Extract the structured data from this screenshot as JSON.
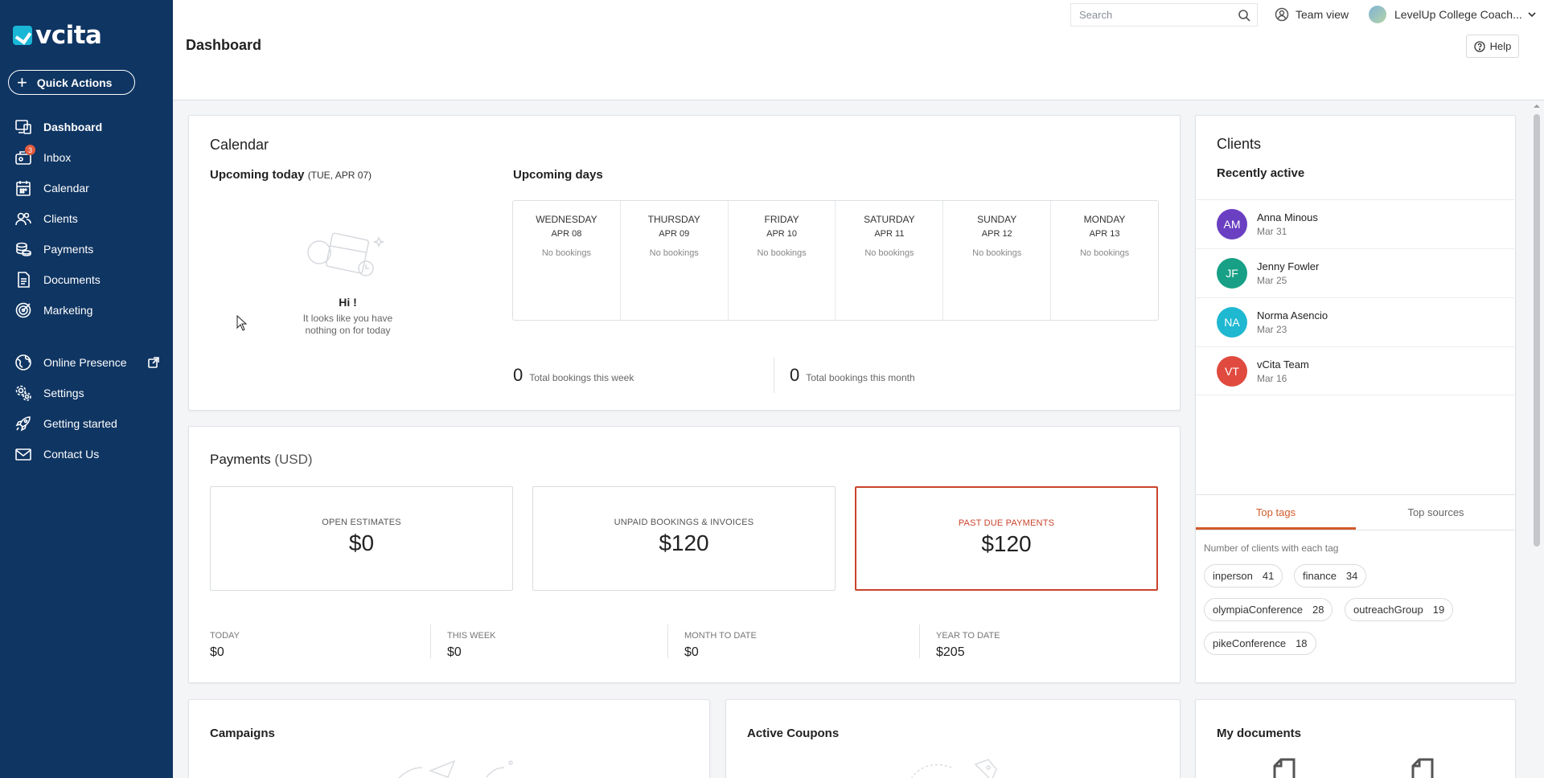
{
  "app": {
    "logo_text": "vcita",
    "quick_actions_label": "Quick Actions"
  },
  "colors": {
    "sidebar_bg": "#0f3562",
    "accent_alert": "#c9442c",
    "tab_active": "#d35a2b"
  },
  "nav": {
    "dashboard": "Dashboard",
    "inbox": "Inbox",
    "inbox_badge": "3",
    "calendar": "Calendar",
    "clients": "Clients",
    "payments": "Payments",
    "documents": "Documents",
    "marketing": "Marketing",
    "online_presence": "Online Presence",
    "settings": "Settings",
    "getting_started": "Getting started",
    "contact_us": "Contact Us"
  },
  "header": {
    "title": "Dashboard",
    "search_placeholder": "Search",
    "team_view": "Team view",
    "account_name": "LevelUp College Coach...",
    "help": "Help"
  },
  "calendar": {
    "title": "Calendar",
    "upcoming_today": "Upcoming today",
    "today_date": "(TUE, APR 07)",
    "upcoming_days": "Upcoming days",
    "hi": "Hi !",
    "empty_line1": "It looks like you have",
    "empty_line2": "nothing on for today",
    "days": [
      {
        "name": "WEDNESDAY",
        "date": "APR 08",
        "status": "No bookings"
      },
      {
        "name": "THURSDAY",
        "date": "APR 09",
        "status": "No bookings"
      },
      {
        "name": "FRIDAY",
        "date": "APR 10",
        "status": "No bookings"
      },
      {
        "name": "SATURDAY",
        "date": "APR 11",
        "status": "No bookings"
      },
      {
        "name": "SUNDAY",
        "date": "APR 12",
        "status": "No bookings"
      },
      {
        "name": "MONDAY",
        "date": "APR 13",
        "status": "No bookings"
      }
    ],
    "week_total": "0",
    "week_label": "Total bookings this week",
    "month_total": "0",
    "month_label": "Total bookings this month"
  },
  "payments": {
    "title": "Payments",
    "currency": "(USD)",
    "boxes": [
      {
        "label": "OPEN ESTIMATES",
        "value": "$0"
      },
      {
        "label": "UNPAID BOOKINGS & INVOICES",
        "value": "$120"
      },
      {
        "label": "PAST DUE PAYMENTS",
        "value": "$120"
      }
    ],
    "stats": [
      {
        "label": "TODAY",
        "value": "$0"
      },
      {
        "label": "THIS WEEK",
        "value": "$0"
      },
      {
        "label": "MONTH TO DATE",
        "value": "$0"
      },
      {
        "label": "YEAR TO DATE",
        "value": "$205"
      }
    ]
  },
  "clients": {
    "title": "Clients",
    "subtitle": "Recently active",
    "list": [
      {
        "initials": "AM",
        "name": "Anna Minous",
        "date": "Mar 31",
        "color": "#6a3fc1"
      },
      {
        "initials": "JF",
        "name": "Jenny Fowler",
        "date": "Mar 25",
        "color": "#17a085"
      },
      {
        "initials": "NA",
        "name": "Norma Asencio",
        "date": "Mar 23",
        "color": "#1fb8d1"
      },
      {
        "initials": "VT",
        "name": "vCita Team",
        "date": "Mar 16",
        "color": "#e04a3f"
      }
    ],
    "tab_tags": "Top tags",
    "tab_sources": "Top sources",
    "tags_caption": "Number of clients with each tag",
    "tags": [
      {
        "name": "inperson",
        "count": "41"
      },
      {
        "name": "finance",
        "count": "34"
      },
      {
        "name": "olympiaConference",
        "count": "28"
      },
      {
        "name": "outreachGroup",
        "count": "19"
      },
      {
        "name": "pikeConference",
        "count": "18"
      }
    ]
  },
  "bottom": {
    "campaigns": "Campaigns",
    "coupons": "Active Coupons",
    "documents": "My documents"
  }
}
